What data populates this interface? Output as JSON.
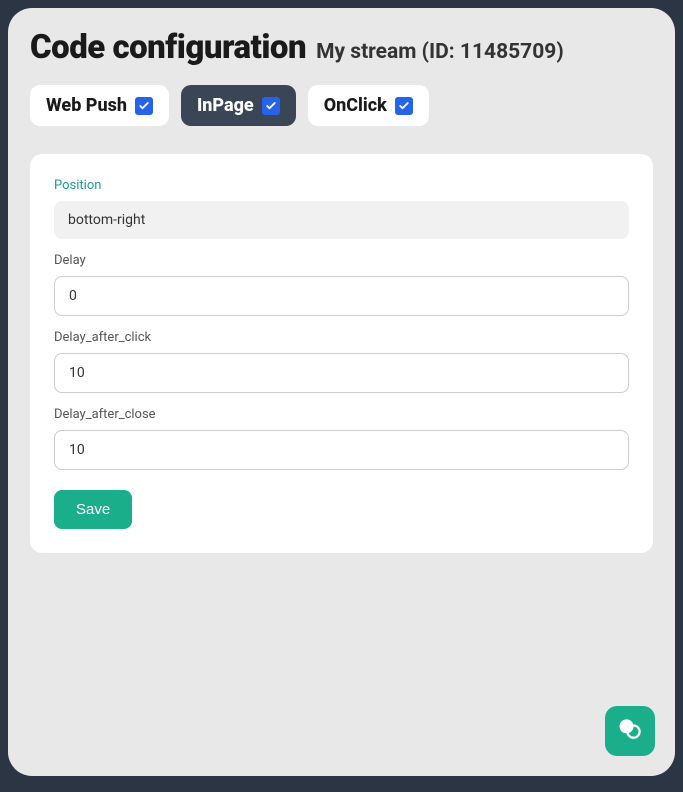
{
  "header": {
    "title": "Code configuration",
    "subtitle": "My stream (ID: 11485709)"
  },
  "tabs": [
    {
      "label": "Web Push",
      "active": false,
      "checked": true
    },
    {
      "label": "InPage",
      "active": true,
      "checked": true
    },
    {
      "label": "OnClick",
      "active": false,
      "checked": true
    }
  ],
  "form": {
    "position": {
      "label": "Position",
      "value": "bottom-right"
    },
    "delay": {
      "label": "Delay",
      "value": "0"
    },
    "delay_after_click": {
      "label": "Delay_after_click",
      "value": "10"
    },
    "delay_after_close": {
      "label": "Delay_after_close",
      "value": "10"
    },
    "save_label": "Save"
  }
}
